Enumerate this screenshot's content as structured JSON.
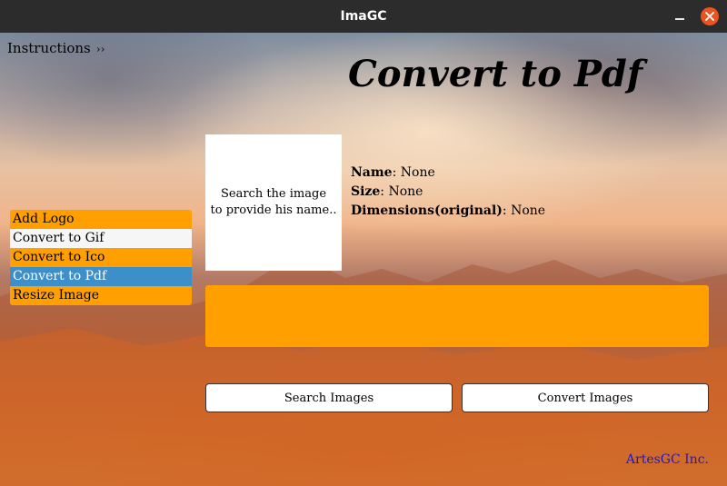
{
  "window": {
    "title": "ImaGC"
  },
  "menu": {
    "instructions_label": "Instructions",
    "instructions_chevron": "››"
  },
  "page": {
    "title": "Convert to Pdf"
  },
  "sidebar": {
    "items": [
      {
        "label": "Add Logo",
        "state": "normal"
      },
      {
        "label": "Convert to Gif",
        "state": "normal"
      },
      {
        "label": "Convert to Ico",
        "state": "normal"
      },
      {
        "label": "Convert to Pdf",
        "state": "selected"
      },
      {
        "label": "Resize Image",
        "state": "normal"
      }
    ]
  },
  "preview": {
    "placeholder_line1": "Search the image",
    "placeholder_line2": "to provide his name.."
  },
  "info": {
    "name_label": "Name",
    "name_value": ": None",
    "size_label": "Size",
    "size_value": ": None",
    "dimensions_label": "Dimensions(original)",
    "dimensions_value": ": None"
  },
  "progress": {
    "value": 0
  },
  "actions": {
    "search_label": "Search Images",
    "convert_label": "Convert Images"
  },
  "footer": {
    "credit": "ArtesGC Inc."
  },
  "colors": {
    "accent": "#ffa000",
    "selected": "#3d8fc9",
    "close_button": "#e95420",
    "footer_link": "#1a1acc"
  }
}
